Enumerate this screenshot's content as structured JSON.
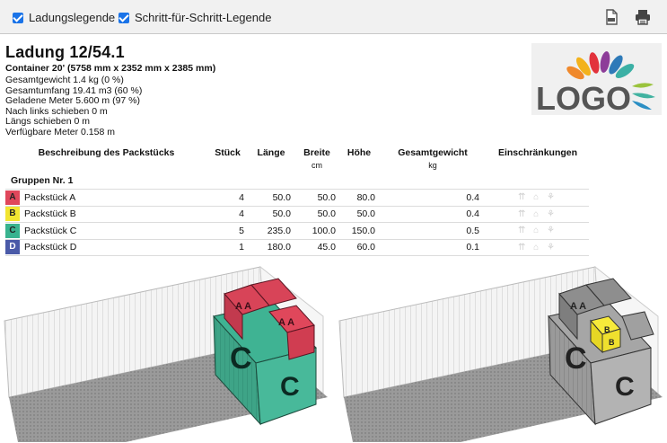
{
  "toolbar": {
    "checkbox1": "Ladungslegende",
    "checkbox2": "Schritt-für-Schritt-Legende",
    "pdf_icon": "pdf-icon",
    "print_icon": "printer-icon"
  },
  "header": {
    "title": "Ladung 12/54.1",
    "container": "Container 20' (5758 mm x 2352 mm x 2385 mm)"
  },
  "stats": [
    "Gesamtgewicht   1.4 kg (0 %)",
    "Gesamtumfang   19.41 m3 (60 %)",
    "Geladene Meter   5.600 m (97 %)",
    "Nach links schieben   0 m",
    "Längs schieben   0 m",
    "Verfügbare Meter   0.158 m"
  ],
  "logo": {
    "text": "LOGO"
  },
  "table": {
    "headers": {
      "desc": "Beschreibung des Packstücks",
      "count": "Stück",
      "length": "Länge",
      "width": "Breite",
      "height": "Höhe",
      "weight": "Gesamtgewicht",
      "restrictions": "Einschränkungen",
      "unit_cm": "cm",
      "unit_kg": "kg"
    },
    "group": "Gruppen Nr. 1",
    "rows": [
      {
        "tag": "A",
        "color": "#e0475b",
        "name": "Packstück A",
        "count": "4",
        "length": "50.0",
        "width": "50.0",
        "height": "80.0",
        "weight": "0.4"
      },
      {
        "tag": "B",
        "color": "#f2e531",
        "name": "Packstück B",
        "count": "4",
        "length": "50.0",
        "width": "50.0",
        "height": "50.0",
        "weight": "0.4"
      },
      {
        "tag": "C",
        "color": "#39b38f",
        "name": "Packstück C",
        "count": "5",
        "length": "235.0",
        "width": "100.0",
        "height": "150.0",
        "weight": "0.5"
      },
      {
        "tag": "D",
        "color": "#4a5aa8",
        "name": "Packstück D",
        "count": "1",
        "length": "180.0",
        "width": "45.0",
        "height": "60.0",
        "weight": "0.1"
      }
    ]
  },
  "colors": {
    "accent": "#1a73e8"
  }
}
